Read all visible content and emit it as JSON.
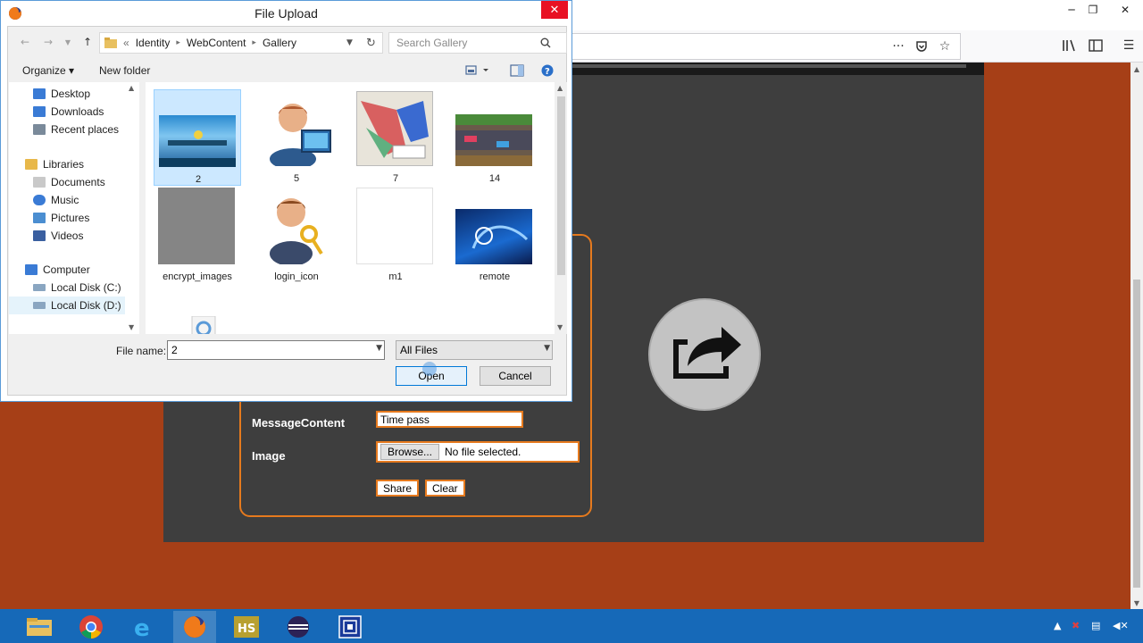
{
  "dialog": {
    "title": "File Upload",
    "breadcrumb": [
      "«",
      "Identity",
      "WebContent",
      "Gallery"
    ],
    "search_placeholder": "Search Gallery",
    "organize_label": "Organize ▾",
    "new_folder_label": "New folder",
    "tree": [
      {
        "label": "Desktop",
        "icon": "desktop-icon",
        "color": "#3a7bd5"
      },
      {
        "label": "Downloads",
        "icon": "downloads-icon",
        "color": "#3a7bd5"
      },
      {
        "label": "Recent places",
        "icon": "recent-places-icon",
        "color": "#7a8a9a"
      },
      {
        "label": "Libraries",
        "icon": "libraries-icon",
        "color": "#e8b84a"
      },
      {
        "label": "Documents",
        "icon": "documents-icon",
        "color": "#c9c9c9"
      },
      {
        "label": "Music",
        "icon": "music-icon",
        "color": "#3a7bd5"
      },
      {
        "label": "Pictures",
        "icon": "pictures-icon",
        "color": "#4b8ed1"
      },
      {
        "label": "Videos",
        "icon": "videos-icon",
        "color": "#3a5fa0"
      },
      {
        "label": "Computer",
        "icon": "computer-icon",
        "color": "#3a7bd5"
      },
      {
        "label": "Local Disk (C:)",
        "icon": "drive-c-icon",
        "color": "#8aa6c1"
      },
      {
        "label": "Local Disk (D:)",
        "icon": "drive-d-icon",
        "color": "#8aa6c1"
      }
    ],
    "files": [
      {
        "label": "2",
        "kind": "underwater-scene"
      },
      {
        "label": "5",
        "kind": "user-computer"
      },
      {
        "label": "7",
        "kind": "map-illustration"
      },
      {
        "label": "14",
        "kind": "racing-game"
      },
      {
        "label": "encrypt_images",
        "kind": "gray-noise"
      },
      {
        "label": "login_icon",
        "kind": "user-key"
      },
      {
        "label": "m1",
        "kind": "blank"
      },
      {
        "label": "remote",
        "kind": "blue-abstract"
      }
    ],
    "file_name_label": "File name:",
    "file_name_value": "2",
    "file_type_value": "All Files",
    "open_label": "Open",
    "cancel_label": "Cancel"
  },
  "page": {
    "message_label": "MessageContent",
    "message_value": "Time pass",
    "image_label": "Image",
    "browse_label": "Browse...",
    "file_status": "No file selected.",
    "share_label": "Share",
    "clear_label": "Clear"
  },
  "colors": {
    "background": "#a63f17",
    "panel": "#3e3e3e",
    "accent": "#e67a1e",
    "taskbar": "#1669b8"
  }
}
